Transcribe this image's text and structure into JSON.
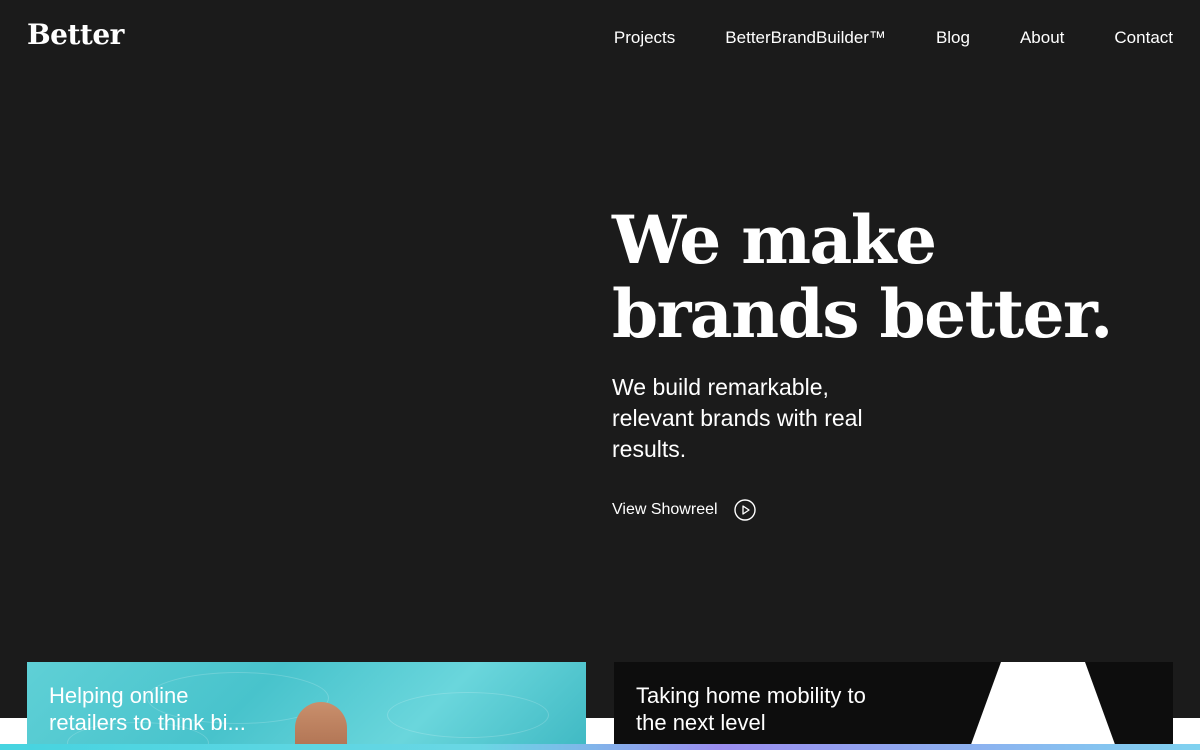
{
  "brand": {
    "logo_text": "Better"
  },
  "nav": {
    "items": [
      {
        "label": "Projects"
      },
      {
        "label": "BetterBrandBuilder™"
      },
      {
        "label": "Blog"
      },
      {
        "label": "About"
      },
      {
        "label": "Contact"
      }
    ]
  },
  "hero": {
    "title_line1": "We make",
    "title_line2": "brands better.",
    "subtitle": "We build remarkable, relevant brands with real results.",
    "cta_label": "View Showreel",
    "cta_icon": "play-circle-icon"
  },
  "cards": [
    {
      "title": "Helping online retailers to think bi...",
      "background": "#4fc6ce"
    },
    {
      "title": "Taking home mobility to the next level",
      "background": "#0d0d0d"
    }
  ],
  "colors": {
    "background": "#1b1b1b",
    "text": "#ffffff",
    "accent_gradient_start": "#46d4e0",
    "accent_gradient_end": "#9b8df0"
  }
}
